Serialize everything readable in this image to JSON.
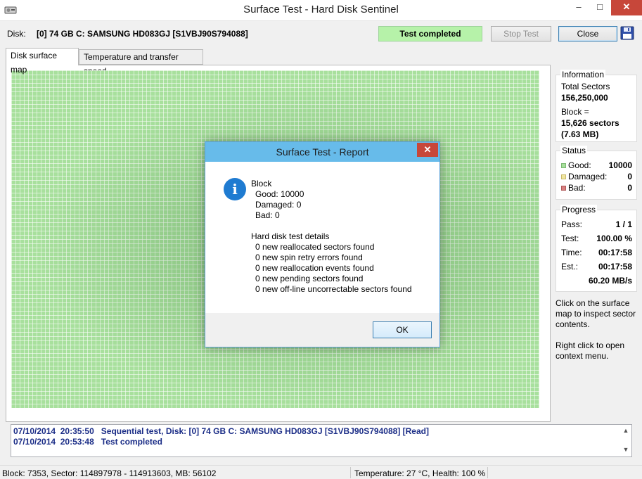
{
  "window": {
    "title": "Surface Test - Hard Disk Sentinel",
    "minimize_glyph": "–",
    "maximize_glyph": "□",
    "close_glyph": "✕"
  },
  "header": {
    "disk_label": "Disk:",
    "disk_name": "[0] 74 GB C: SAMSUNG HD083GJ [S1VBJ90S794088]",
    "status": "Test completed",
    "stop_button": "Stop Test",
    "close_button": "Close",
    "save_icon": "floppy-disk-icon"
  },
  "tabs": [
    {
      "label": "Disk surface map",
      "active": true
    },
    {
      "label": "Temperature and transfer speed",
      "active": false
    }
  ],
  "information": {
    "title": "Information",
    "total_sectors_label": "Total Sectors",
    "total_sectors_value": "156,250,000",
    "block_label": "Block =",
    "block_sectors": "15,626 sectors",
    "block_size": "(7.63 MB)"
  },
  "status": {
    "title": "Status",
    "good_label": "Good:",
    "good_value": "10000",
    "damaged_label": "Damaged:",
    "damaged_value": "0",
    "bad_label": "Bad:",
    "bad_value": "0",
    "colors": {
      "good": "#a8e09d",
      "damaged": "#f0e6a0",
      "bad": "#d98080"
    }
  },
  "progress": {
    "title": "Progress",
    "pass_label": "Pass:",
    "pass_value": "1 / 1",
    "test_label": "Test:",
    "test_value": "100.00 %",
    "time_label": "Time:",
    "time_value": "00:17:58",
    "est_label": "Est.:",
    "est_value": "00:17:58",
    "speed": "60.20 MB/s"
  },
  "help": {
    "surface_hint": "Click on the surface map to inspect sector contents.",
    "context_hint": "Right click to open context menu."
  },
  "log": [
    {
      "date": "07/10/2014",
      "time": "20:35:50",
      "message": "Sequential test, Disk: [0] 74 GB C: SAMSUNG HD083GJ [S1VBJ90S794088] [Read]"
    },
    {
      "date": "07/10/2014",
      "time": "20:53:48",
      "message": "Test completed"
    }
  ],
  "statusbar": {
    "left": "Block: 7353, Sector: 114897978 - 114913603, MB: 56102",
    "right": "Temperature: 27  °C,  Health: 100 %"
  },
  "dialog": {
    "title": "Surface Test - Report",
    "close_glyph": "✕",
    "icon": "information-icon",
    "icon_glyph": "i",
    "block_heading": "Block",
    "good": "Good: 10000",
    "damaged": "Damaged: 0",
    "bad": "Bad: 0",
    "details_heading": "Hard disk test details",
    "details": [
      "0 new reallocated sectors found",
      "0 new spin retry errors found",
      "0 new reallocation events found",
      "0 new pending sectors found",
      "0 new off-line uncorrectable sectors found"
    ],
    "ok_button": "OK"
  }
}
